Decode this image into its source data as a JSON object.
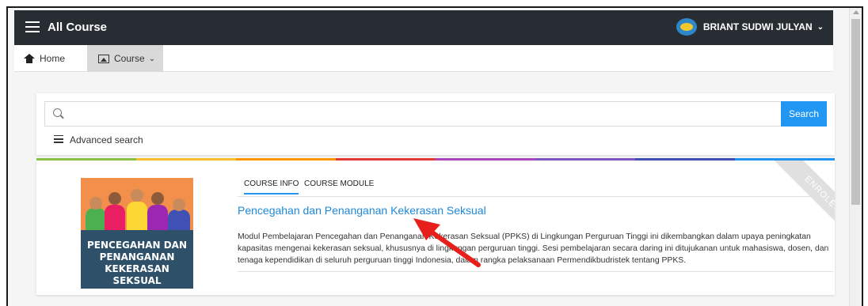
{
  "navbar": {
    "title": "All Course",
    "user_name": "BRIANT SUDWI JULYAN",
    "chevron": "⌄"
  },
  "subnav": {
    "home_label": "Home",
    "course_label": "Course",
    "course_chevron": "⌄"
  },
  "search": {
    "placeholder": "",
    "value": "",
    "button_label": "Search",
    "advanced_label": "Advanced search"
  },
  "color_strip": [
    "#8bc34a",
    "#fbc02d",
    "#ff9800",
    "#e53935",
    "#ab47bc",
    "#7e57c2",
    "#3f51b5",
    "#2196f3"
  ],
  "course": {
    "image_text": [
      "PENCEGAHAN DAN",
      "PENANGANAN",
      "KEKERASAN SEKSUAL"
    ],
    "tabs": [
      "COURSE INFO",
      "COURSE MODULE"
    ],
    "title": "Pencegahan dan Penanganan Kekerasan Seksual",
    "description": "Modul Pembelajaran Pencegahan dan Penanganan Kekerasan Seksual (PPKS) di Lingkungan Perguruan Tinggi ini dikembangkan dalam upaya peningkatan kapasitas mengenai kekerasan seksual, khususnya di lingkungan perguruan tinggi. Sesi pembelajaran secara daring ini ditujukanan untuk mahasiswa, dosen, dan tenaga kependidikan di seluruh perguruan tinggi Indonesia, dalam rangka pelaksanaan Permendikbudristek tentang PPKS.",
    "ribbon": "ENROLED"
  },
  "colors": {
    "navbar": "#272d33",
    "accent": "#2196f3",
    "title": "#1e88d6",
    "arrow": "#e8201c"
  },
  "icons": [
    "menu-icon",
    "kemendikbud-logo-icon",
    "home-icon",
    "image-icon",
    "search-icon",
    "list-icon"
  ]
}
